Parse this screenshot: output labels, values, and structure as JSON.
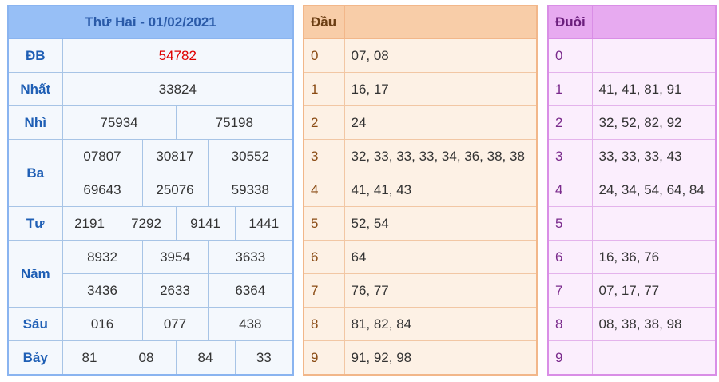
{
  "results": {
    "title": "Thứ Hai - 01/02/2021",
    "rows": [
      {
        "label": "ĐB",
        "values": [
          "54782"
        ]
      },
      {
        "label": "Nhất",
        "values": [
          "33824"
        ]
      },
      {
        "label": "Nhì",
        "values": [
          "75934",
          "75198"
        ]
      },
      {
        "label": "Ba",
        "values": [
          "07807",
          "30817",
          "30552",
          "69643",
          "25076",
          "59338"
        ]
      },
      {
        "label": "Tư",
        "values": [
          "2191",
          "7292",
          "9141",
          "1441"
        ]
      },
      {
        "label": "Năm",
        "values": [
          "8932",
          "3954",
          "3633",
          "3436",
          "2633",
          "6364"
        ]
      },
      {
        "label": "Sáu",
        "values": [
          "016",
          "077",
          "438"
        ]
      },
      {
        "label": "Bảy",
        "values": [
          "81",
          "08",
          "84",
          "33"
        ]
      }
    ]
  },
  "dau": {
    "header": "Đầu",
    "rows": [
      {
        "key": "0",
        "values": "07, 08"
      },
      {
        "key": "1",
        "values": "16, 17"
      },
      {
        "key": "2",
        "values": "24"
      },
      {
        "key": "3",
        "values": "32, 33, 33, 33, 34, 36, 38, 38"
      },
      {
        "key": "4",
        "values": "41, 41, 43"
      },
      {
        "key": "5",
        "values": "52, 54"
      },
      {
        "key": "6",
        "values": "64"
      },
      {
        "key": "7",
        "values": "76, 77"
      },
      {
        "key": "8",
        "values": "81, 82, 84"
      },
      {
        "key": "9",
        "values": "91, 92, 98"
      }
    ]
  },
  "duoi": {
    "header": "Đuôi",
    "rows": [
      {
        "key": "0",
        "values": ""
      },
      {
        "key": "1",
        "values": "41, 41, 81, 91"
      },
      {
        "key": "2",
        "values": "32, 52, 82, 92"
      },
      {
        "key": "3",
        "values": "33, 33, 33, 43"
      },
      {
        "key": "4",
        "values": "24, 34, 54, 64, 84"
      },
      {
        "key": "5",
        "values": ""
      },
      {
        "key": "6",
        "values": "16, 36, 76"
      },
      {
        "key": "7",
        "values": "07, 17, 77"
      },
      {
        "key": "8",
        "values": "08, 38, 38, 98"
      },
      {
        "key": "9",
        "values": ""
      }
    ]
  }
}
